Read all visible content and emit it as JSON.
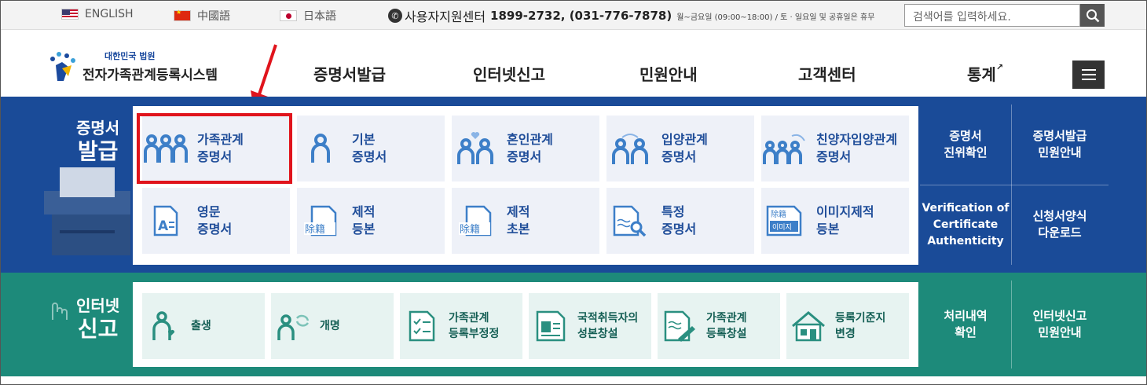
{
  "topbar": {
    "languages": [
      {
        "label": "ENGLISH",
        "flag": "us-flag-icon"
      },
      {
        "label": "中國語",
        "flag": "china-flag-icon"
      },
      {
        "label": "日本語",
        "flag": "japan-flag-icon"
      }
    ],
    "support_label": "사용자지원센터",
    "support_phone": "1899-2732, (031-776-7878)",
    "support_hours": "월~금요일 (09:00~18:00) / 토 · 일요일 및 공휴일은 휴무",
    "search_placeholder": "검색어를 입력하세요."
  },
  "header": {
    "logo_small": "대한민국 법원",
    "logo_big": "전자가족관계등록시스템",
    "nav": [
      "증명서발급",
      "인터넷신고",
      "민원안내",
      "고객센터",
      "통계"
    ]
  },
  "cert": {
    "label_line1": "증명서",
    "label_line2": "발급",
    "tiles": [
      {
        "l1": "가족관계",
        "l2": "증명서",
        "icon": "family-icon"
      },
      {
        "l1": "기본",
        "l2": "증명서",
        "icon": "person-icon"
      },
      {
        "l1": "혼인관계",
        "l2": "증명서",
        "icon": "couple-heart-icon"
      },
      {
        "l1": "입양관계",
        "l2": "증명서",
        "icon": "adoption-icon"
      },
      {
        "l1": "친양자입양관계",
        "l2": "증명서",
        "icon": "full-adoption-icon"
      },
      {
        "l1": "영문",
        "l2": "증명서",
        "icon": "english-document-icon"
      },
      {
        "l1": "제적",
        "l2": "등본",
        "icon": "removed-register-icon"
      },
      {
        "l1": "제적",
        "l2": "초본",
        "icon": "removed-register-excerpt-icon"
      },
      {
        "l1": "특정",
        "l2": "증명서",
        "icon": "document-search-icon"
      },
      {
        "l1": "이미지제적",
        "l2": "등본",
        "icon": "image-register-icon"
      }
    ],
    "stamp_text": "除籍",
    "image_stamp_top": "除籍",
    "image_stamp_bottom": "이미지",
    "side": [
      {
        "l1": "증명서",
        "l2": "진위확인"
      },
      {
        "l1": "증명서발급",
        "l2": "민원안내"
      },
      {
        "l1": "Verification of",
        "l2": "Certificate",
        "l3": "Authenticity"
      },
      {
        "l1": "신청서양식",
        "l2": "다운로드"
      }
    ]
  },
  "net": {
    "label_line1": "인터넷",
    "label_line2": "신고",
    "tiles": [
      {
        "l1": "출생",
        "l2": "",
        "icon": "birth-icon"
      },
      {
        "l1": "개명",
        "l2": "",
        "icon": "rename-icon"
      },
      {
        "l1": "가족관계",
        "l2": "등록부정정",
        "icon": "checklist-document-icon"
      },
      {
        "l1": "국적취득자의",
        "l2": "성본창설",
        "icon": "id-card-icon"
      },
      {
        "l1": "가족관계",
        "l2": "등록창설",
        "icon": "document-pen-icon"
      },
      {
        "l1": "등록기준지",
        "l2": "변경",
        "icon": "house-icon"
      }
    ],
    "side": [
      {
        "l1": "처리내역",
        "l2": "확인"
      },
      {
        "l1": "인터넷신고",
        "l2": "민원안내"
      }
    ]
  },
  "colors": {
    "blue": "#1a4b98",
    "green": "#1d8a7a",
    "highlight": "#e0141c"
  }
}
